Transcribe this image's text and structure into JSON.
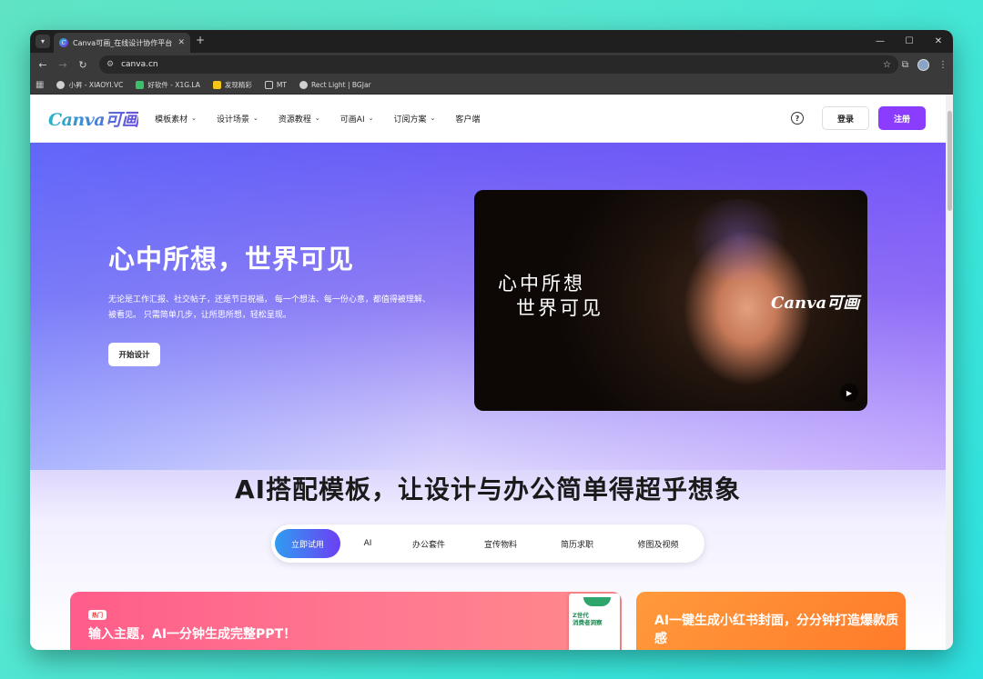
{
  "browser": {
    "tab_title": "Canva可画_在线设计协作平台",
    "url": "canva.cn",
    "bookmarks": [
      {
        "label": "小昇 - XIAOYI.VC",
        "color": "#cfcfcf"
      },
      {
        "label": "好软件 - X1G.LA",
        "color": "#3bbf6a"
      },
      {
        "label": "发现精彩",
        "color": "#f5c518"
      },
      {
        "label": "MT",
        "color": "#3a3a3a"
      },
      {
        "label": "Rect Light | BGJar",
        "color": "#cfcfcf"
      }
    ]
  },
  "nav": {
    "logo": "Canva可画",
    "items": [
      {
        "label": "模板素材",
        "has_chevron": true
      },
      {
        "label": "设计场景",
        "has_chevron": true
      },
      {
        "label": "资源教程",
        "has_chevron": true
      },
      {
        "label": "可画AI",
        "has_chevron": true
      },
      {
        "label": "订阅方案",
        "has_chevron": true
      },
      {
        "label": "客户端",
        "has_chevron": false
      }
    ],
    "login": "登录",
    "signup": "注册",
    "help": "?"
  },
  "hero": {
    "title": "心中所想，世界可见",
    "description": "无论是工作汇报、社交帖子，还是节日祝福， 每一个想法、每一份心意，都值得被理解、被看见。 只需简单几步，让所思所想，轻松呈现。",
    "cta": "开始设计",
    "media_line1": "心中所想",
    "media_line2": "世界可见",
    "media_logo": "Canva可画"
  },
  "templates_section": {
    "title": "AI搭配模板，让设计与办公简单得超乎想象",
    "tabs": [
      {
        "label": "立即试用",
        "active": true
      },
      {
        "label": "AI",
        "active": false
      },
      {
        "label": "办公套件",
        "active": false
      },
      {
        "label": "宣传物料",
        "active": false
      },
      {
        "label": "简历求职",
        "active": false
      },
      {
        "label": "修图及视频",
        "active": false
      }
    ],
    "card_left": {
      "badge": "热门",
      "title": "输入主题，AI一分钟生成完整PPT！",
      "mini_doc_text": "Z世代\n消费者洞察"
    },
    "card_right": {
      "title": "AI一键生成小红书封面，分分钟打造爆款质感"
    }
  },
  "colors": {
    "brand_purple": "#8b3dff",
    "card_left": "#ff5d8a",
    "card_right": "#ff8a3c"
  }
}
